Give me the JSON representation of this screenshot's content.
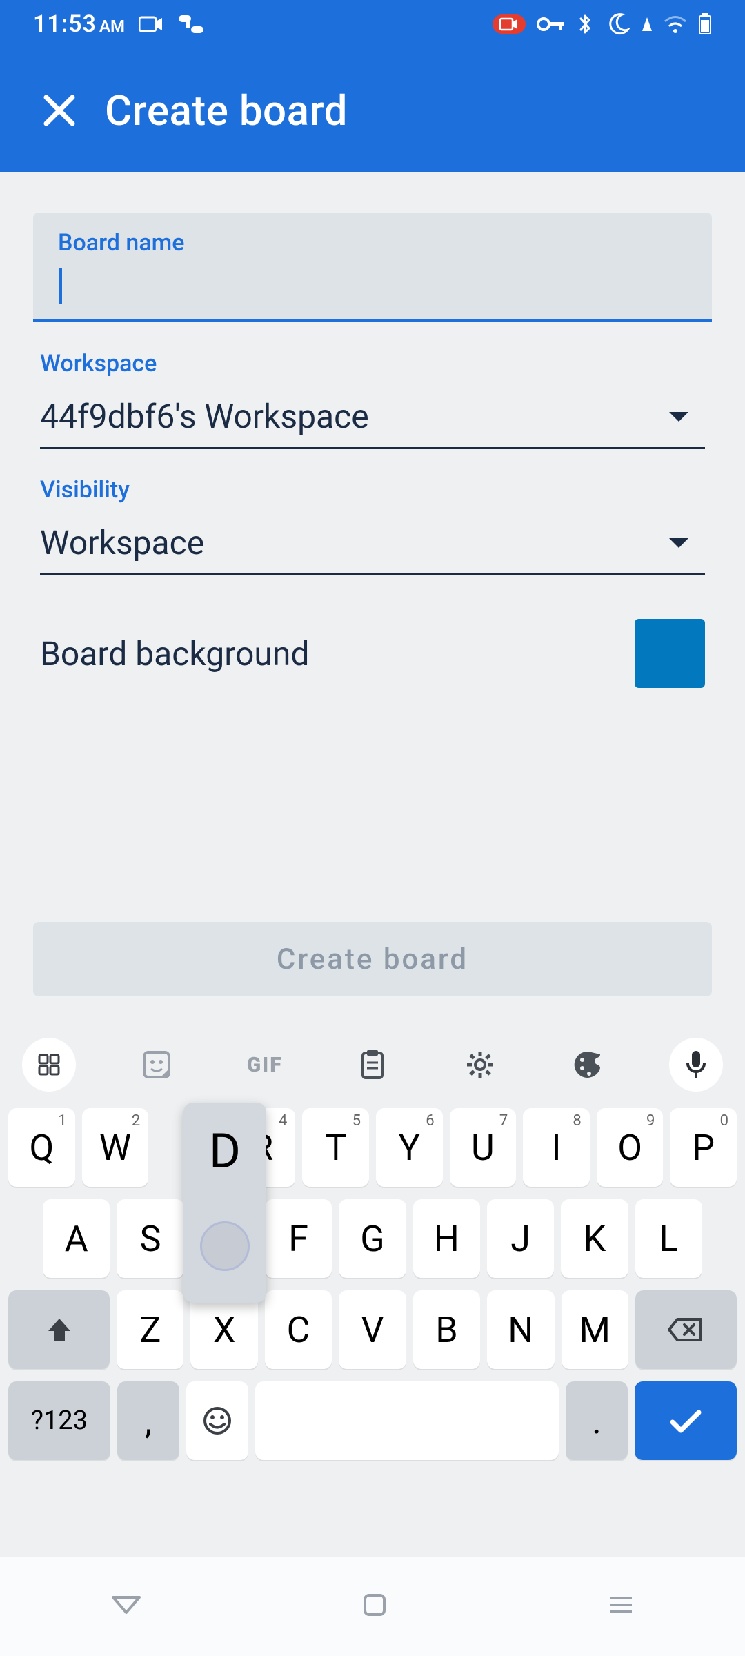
{
  "status": {
    "time": "11:53",
    "ampm": "AM"
  },
  "header": {
    "title": "Create board"
  },
  "form": {
    "board_name_label": "Board name",
    "board_name_value": "",
    "workspace_label": "Workspace",
    "workspace_value": "44f9dbf6's Workspace",
    "visibility_label": "Visibility",
    "visibility_value": "Workspace",
    "background_label": "Board background",
    "background_color": "#0279bf",
    "create_button": "Create board"
  },
  "keyboard": {
    "gif_label": "GIF",
    "row1": [
      {
        "k": "Q",
        "s": "1"
      },
      {
        "k": "W",
        "s": "2"
      },
      {
        "k": "",
        "s": "",
        "hidden": true
      },
      {
        "k": "R",
        "s": "4"
      },
      {
        "k": "T",
        "s": "5"
      },
      {
        "k": "Y",
        "s": "6"
      },
      {
        "k": "U",
        "s": "7"
      },
      {
        "k": "I",
        "s": "8"
      },
      {
        "k": "O",
        "s": "9"
      },
      {
        "k": "P",
        "s": "0"
      }
    ],
    "row2": [
      "A",
      "S",
      "",
      "F",
      "G",
      "H",
      "J",
      "K",
      "L"
    ],
    "row3": [
      "Z",
      "X",
      "C",
      "V",
      "B",
      "N",
      "M"
    ],
    "symkey": "?123",
    "comma": ",",
    "period": ".",
    "popup_letter": "D"
  }
}
